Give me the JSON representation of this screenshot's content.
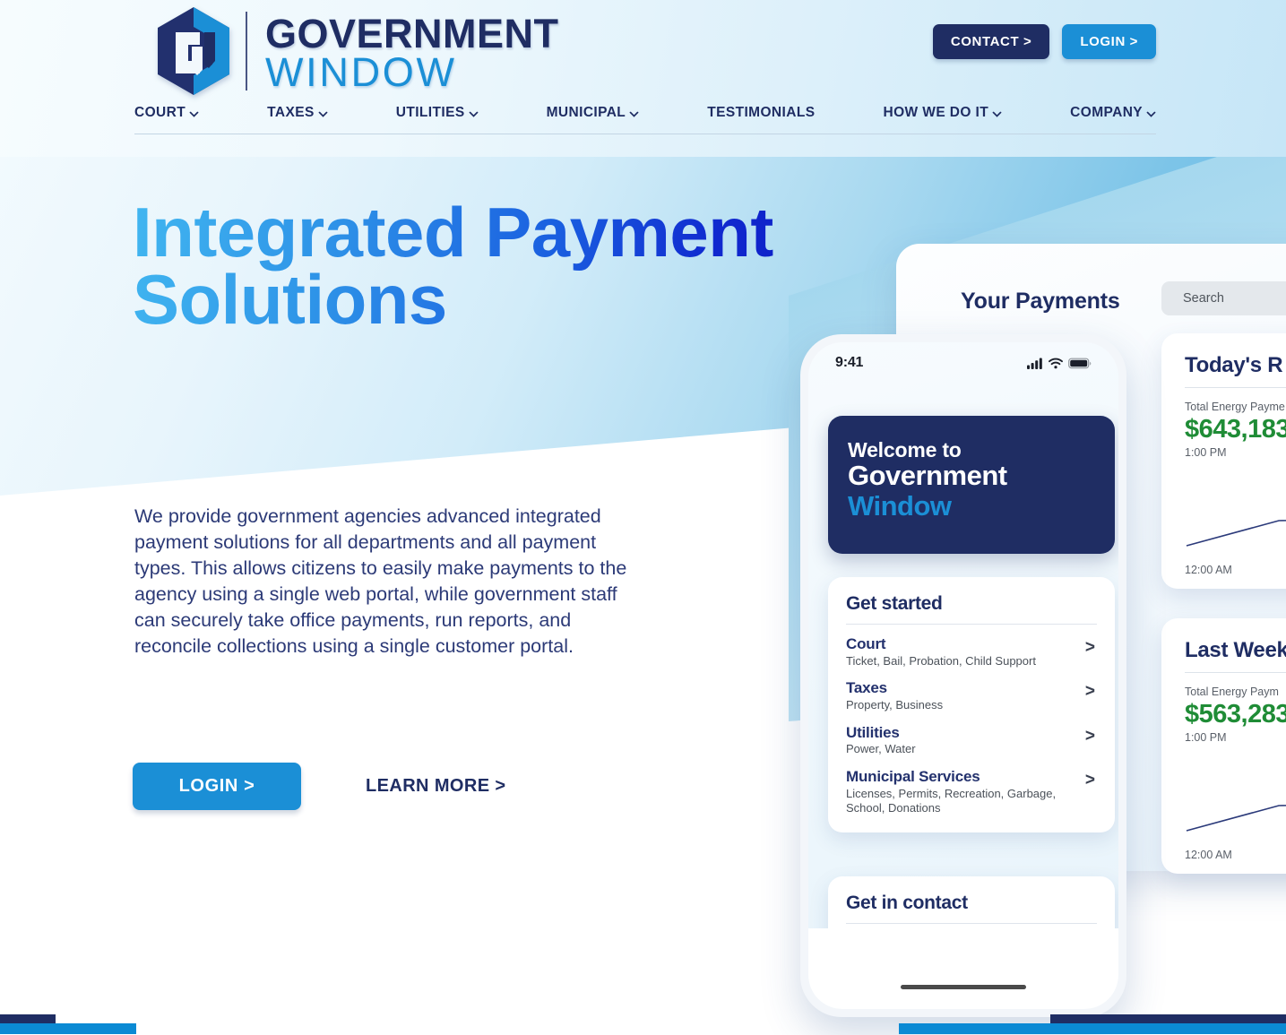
{
  "brand": {
    "logo_icon": "gw-hexagon-logo-icon",
    "name_line1": "GOVERNMENT",
    "name_line2": "WINDOW",
    "navy": "#1f2d63",
    "blue": "#1b8fd6",
    "green": "#1f8c36"
  },
  "header": {
    "buttons": [
      {
        "label": "CONTACT >",
        "name": "contact-button"
      },
      {
        "label": "LOGIN >",
        "name": "login-button"
      }
    ],
    "nav": [
      {
        "label": "COURT",
        "caret": true
      },
      {
        "label": "TAXES",
        "caret": true
      },
      {
        "label": "UTILITIES",
        "caret": true
      },
      {
        "label": "MUNICIPAL",
        "caret": true
      },
      {
        "label": "TESTIMONIALS",
        "caret": false
      },
      {
        "label": "HOW WE DO IT",
        "caret": true
      },
      {
        "label": "COMPANY",
        "caret": true
      }
    ]
  },
  "hero": {
    "title_line1": "Integrated Payment",
    "title_line2": "Solutions",
    "paragraph": "We provide government agencies advanced integrated payment solutions for all departments and all payment types. This allows citizens to easily make payments to the agency using a single web portal, while government staff can securely take office payments, run reports, and reconcile collections using a single customer portal.",
    "cta_primary": "LOGIN >",
    "cta_secondary": "LEARN MORE >"
  },
  "dashboard": {
    "title": "Your Payments",
    "search_placeholder": "Search",
    "cards": [
      {
        "title": "Today's R",
        "metric_label": "Total Energy Payme",
        "amount": "$643,183",
        "amount_time": "1:00 PM",
        "axis_start": "12:00 AM"
      },
      {
        "title": "Last Week",
        "metric_label": "Total Energy Paym",
        "amount": "$563,283",
        "amount_time": "1:00 PM",
        "axis_start": "12:00 AM"
      }
    ]
  },
  "phone": {
    "status_time": "9:41",
    "status_icons": [
      "cellular-signal-icon",
      "wifi-icon",
      "battery-icon"
    ],
    "welcome": {
      "line1": "Welcome to",
      "line2": "Government",
      "line3": "Window"
    },
    "get_started": {
      "heading": "Get started",
      "items": [
        {
          "title": "Court",
          "desc": "Ticket, Bail, Probation, Child Support",
          "arrow": ">"
        },
        {
          "title": "Taxes",
          "desc": "Property, Business",
          "arrow": ">"
        },
        {
          "title": "Utilities",
          "desc": "Power, Water",
          "arrow": ">"
        },
        {
          "title": "Municipal Services",
          "desc": "Licenses, Permits, Recreation, Garbage, School, Donations",
          "arrow": ">"
        }
      ]
    },
    "get_contact": {
      "heading": "Get in contact"
    }
  }
}
